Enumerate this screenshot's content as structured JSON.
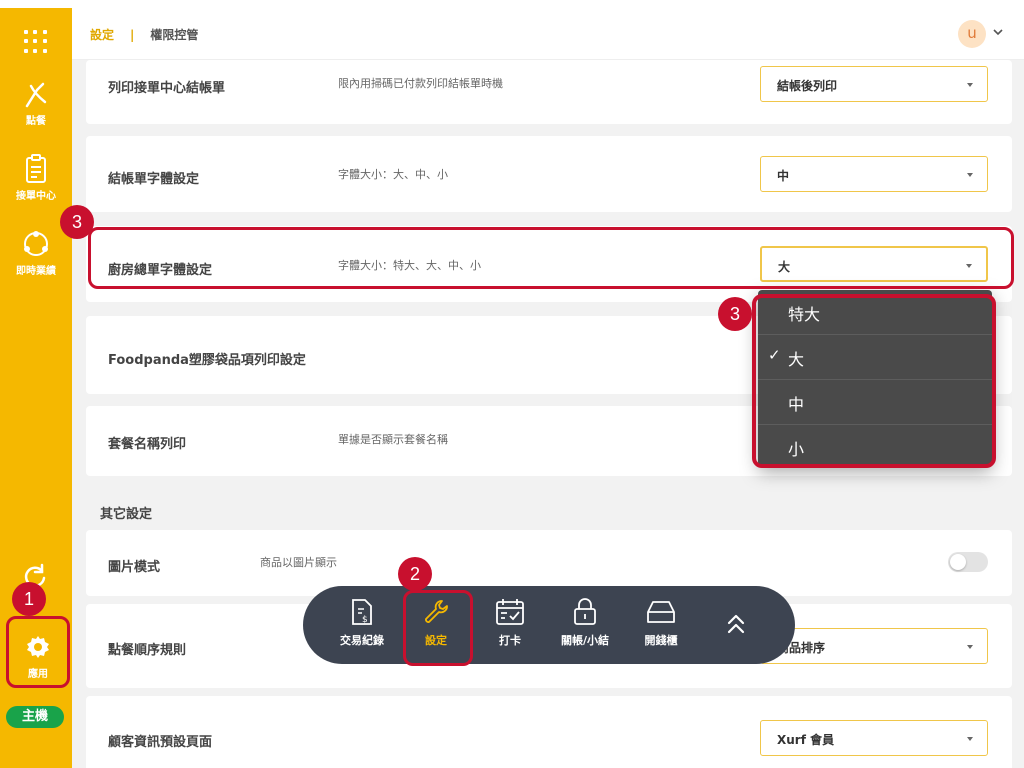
{
  "sidebar": {
    "items": [
      {
        "label": "點餐",
        "icon": "order-icon"
      },
      {
        "label": "接單中心",
        "icon": "clipboard-icon"
      },
      {
        "label": "即時業績",
        "icon": "chart-icon"
      }
    ],
    "app_label": "應用",
    "host_badge": "主機"
  },
  "header": {
    "breadcrumb": [
      "設定",
      "|",
      "權限控管"
    ],
    "avatar_initial": "u"
  },
  "settings": [
    {
      "title": "列印接單中心結帳單",
      "desc": "限內用掃碼已付款列印結帳單時機",
      "value": "結帳後列印"
    },
    {
      "title": "結帳單字體設定",
      "desc": "字體大小：大、中、小",
      "value": "中"
    },
    {
      "title": "廚房總單字體設定",
      "desc": "字體大小：特大、大、中、小",
      "value": "大"
    },
    {
      "title": "Foodpanda塑膠袋品項列印設定"
    },
    {
      "title": "套餐名稱列印",
      "desc": "單據是否顯示套餐名稱"
    }
  ],
  "other_section": {
    "title": "其它設定",
    "rows": [
      {
        "title": "圖片模式",
        "desc": "商品以圖片顯示",
        "toggle_on": false
      },
      {
        "title": "點餐順序規則",
        "value": "商品排序"
      },
      {
        "title": "顧客資訊預設頁面",
        "value": "Xurf 會員"
      }
    ]
  },
  "dropdown": {
    "options": [
      "特大",
      "大",
      "中",
      "小"
    ],
    "selected": "大",
    "check_mark": "✓"
  },
  "toolbar": {
    "items": [
      {
        "label": "交易紀錄",
        "icon": "receipt-icon"
      },
      {
        "label": "設定",
        "icon": "wrench-icon"
      },
      {
        "label": "打卡",
        "icon": "calendar-check-icon"
      },
      {
        "label": "關帳/小結",
        "icon": "lock-icon"
      },
      {
        "label": "開錢櫃",
        "icon": "cash-drawer-icon"
      }
    ],
    "expand_icon": "double-chevron-up-icon"
  },
  "annotations": [
    "1",
    "2",
    "3",
    "3"
  ],
  "colors": {
    "sidebar": "#f5b800",
    "accent": "#e0a800",
    "highlight": "#c8102e",
    "toolbar": "#3d4451",
    "dropdown": "#4a4a4a",
    "host_badge": "#19a34a"
  }
}
